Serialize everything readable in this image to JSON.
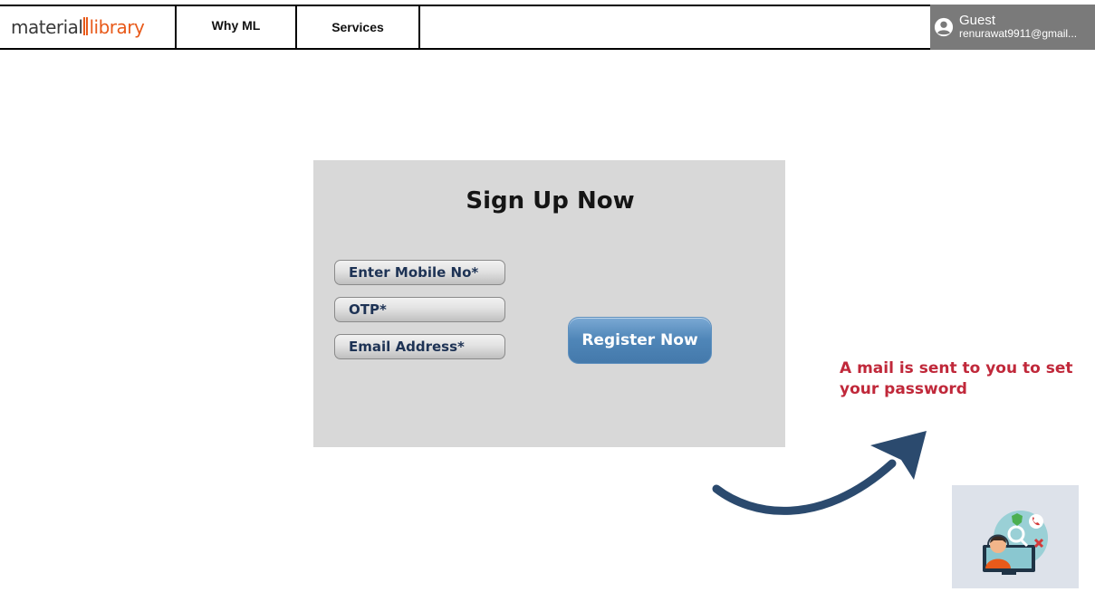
{
  "header": {
    "logo_part1": "material",
    "logo_part2": "library",
    "nav": [
      {
        "label": "Why ML"
      },
      {
        "label": "Services"
      }
    ],
    "user": {
      "name": "Guest",
      "email": "renurawat9911@gmail...",
      "icon": "user-circle-icon"
    }
  },
  "signup": {
    "title": "Sign Up Now",
    "fields": [
      {
        "label": "Enter Mobile No*"
      },
      {
        "label": "OTP*"
      },
      {
        "label": "Email Address*"
      }
    ],
    "register_label": "Register Now"
  },
  "annotation": {
    "text": "A mail is sent to you to set your password",
    "arrow_icon": "curved-arrow-icon"
  },
  "support_widget": {
    "icon": "customer-support-icon"
  },
  "colors": {
    "brand_orange": "#e85a1a",
    "card_bg": "#d8d8d8",
    "button_blue": "#4f86b8",
    "annotation_red": "#c0283a",
    "user_box_bg": "#7a7a7a",
    "arrow_navy": "#2b4a6e"
  }
}
